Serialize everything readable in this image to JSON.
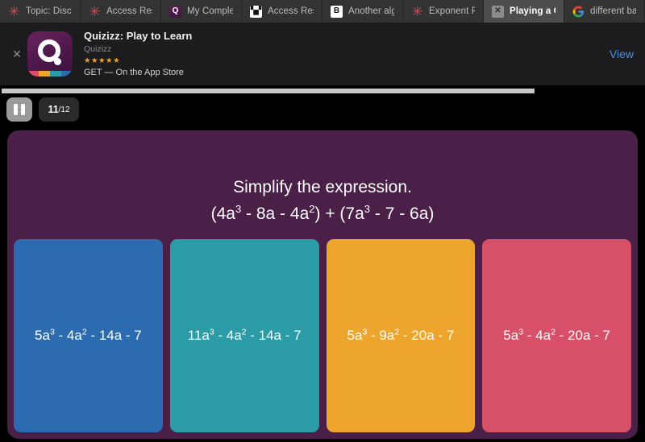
{
  "browser": {
    "tabs": [
      {
        "label": "Topic: Discu",
        "icon": "canvas-icon",
        "active": false
      },
      {
        "label": "Access Rest…",
        "icon": "canvas-icon",
        "active": false
      },
      {
        "label": "My Complet…",
        "icon": "quizizz-icon",
        "active": false
      },
      {
        "label": "Access Rest…",
        "icon": "qr-code-icon",
        "active": false
      },
      {
        "label": "Another alge…",
        "icon": "brainly-icon",
        "active": false
      },
      {
        "label": "Exponent Pr…",
        "icon": "canvas-icon",
        "active": false
      },
      {
        "label": "Playing a Ga…",
        "icon": "close-box-icon",
        "active": true
      },
      {
        "label": "different bas…",
        "icon": "google-icon",
        "active": false
      }
    ]
  },
  "banner": {
    "close_icon": "✕",
    "app_icon": "quizizz-app-icon",
    "title": "Quizizz: Play to Learn",
    "developer": "Quizizz",
    "stars": "★★★★★",
    "price_line": "GET — On the App Store",
    "view_label": "View"
  },
  "quiz": {
    "progress_percent": 83,
    "pause_icon": "pause-icon",
    "question_counter": "11",
    "question_total": "/12",
    "question_line1": "Simplify the expression.",
    "question_expression_parts": [
      "(4a",
      "3",
      " - 8a - 4a",
      "2",
      ") + (7a",
      "3",
      " - 7 - 6a)"
    ],
    "background_color": "#4a2049",
    "options": [
      {
        "color": "#2c6bb0",
        "base": "5a",
        "exp1": "3",
        "mid": " - 4a",
        "exp2": "2",
        "tail": " - 14a - 7",
        "full_text": "5a3 - 4a2 - 14a - 7"
      },
      {
        "color": "#2b9ba5",
        "base": "11a",
        "exp1": "3",
        "mid": " - 4a",
        "exp2": "2",
        "tail": " - 14a - 7",
        "full_text": "11a3 - 4a2 - 14a - 7"
      },
      {
        "color": "#eda52e",
        "base": "5a",
        "exp1": "3",
        "mid": " - 9a",
        "exp2": "2",
        "tail": " - 20a - 7",
        "full_text": "5a3 - 9a2 - 20a - 7"
      },
      {
        "color": "#d75068",
        "base": "5a",
        "exp1": "3",
        "mid": " - 4a",
        "exp2": "2",
        "tail": " - 20a - 7",
        "full_text": "5a3 - 4a2 - 20a - 7"
      }
    ]
  }
}
